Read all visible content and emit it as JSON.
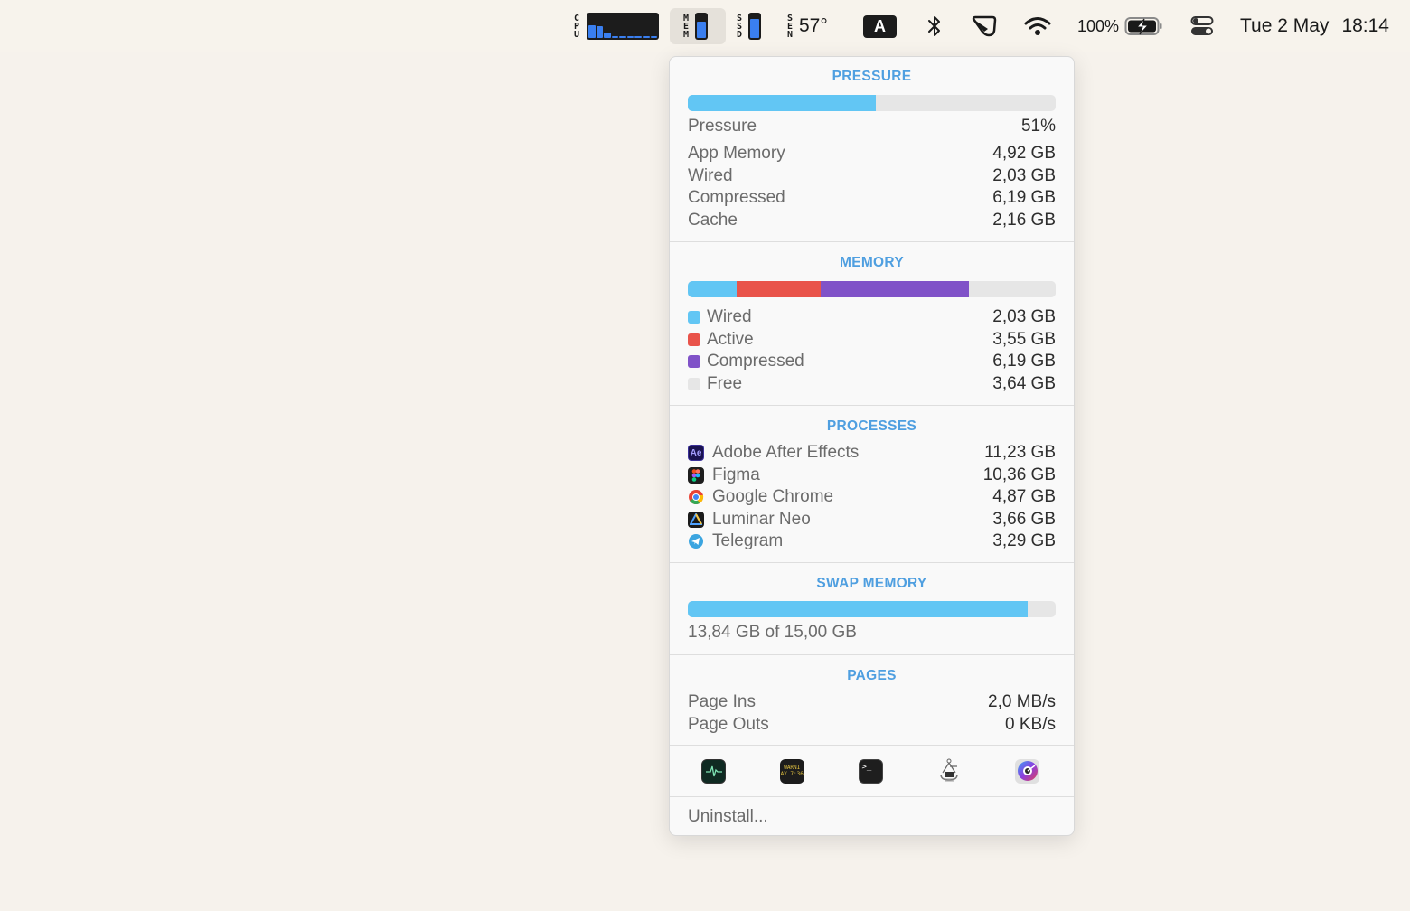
{
  "menubar": {
    "cpu": {
      "label": [
        "C",
        "P",
        "U"
      ],
      "bars": [
        0.55,
        0.5,
        0.22,
        0.05,
        0.05,
        0.05,
        0.05,
        0.05,
        0.05
      ]
    },
    "mem": {
      "label": [
        "M",
        "E",
        "M"
      ],
      "level": 0.7
    },
    "ssd": {
      "label": [
        "S",
        "S",
        "D"
      ],
      "level": 0.8
    },
    "sensors": {
      "label": [
        "S",
        "E",
        "N"
      ],
      "value": "57°"
    },
    "input_source": "A",
    "battery": "100%",
    "date": "Tue 2 May",
    "time": "18:14"
  },
  "colors": {
    "accent": "#4f9fe0",
    "wired": "#62c6f4",
    "active": "#e9534a",
    "compressed": "#8052c8",
    "free": "#e6e6e6"
  },
  "pressure": {
    "title": "PRESSURE",
    "level": 0.51,
    "summary": {
      "label": "Pressure",
      "value": "51%"
    },
    "rows": [
      {
        "label": "App Memory",
        "value": "4,92 GB"
      },
      {
        "label": "Wired",
        "value": "2,03 GB"
      },
      {
        "label": "Compressed",
        "value": "6,19 GB"
      },
      {
        "label": "Cache",
        "value": "2,16 GB"
      }
    ]
  },
  "memory": {
    "title": "MEMORY",
    "rows": [
      {
        "label": "Wired",
        "value": "2,03 GB",
        "gb": 2.03,
        "color": "#62c6f4"
      },
      {
        "label": "Active",
        "value": "3,55 GB",
        "gb": 3.55,
        "color": "#e9534a"
      },
      {
        "label": "Compressed",
        "value": "6,19 GB",
        "gb": 6.19,
        "color": "#8052c8"
      },
      {
        "label": "Free",
        "value": "3,64 GB",
        "gb": 3.64,
        "color": "#e6e6e6"
      }
    ]
  },
  "processes": {
    "title": "PROCESSES",
    "rows": [
      {
        "icon": "after-effects-icon",
        "label": "Adobe After Effects",
        "value": "11,23 GB"
      },
      {
        "icon": "figma-icon",
        "label": "Figma",
        "value": "10,36 GB"
      },
      {
        "icon": "chrome-icon",
        "label": "Google Chrome",
        "value": "4,87 GB"
      },
      {
        "icon": "luminar-neo-icon",
        "label": "Luminar Neo",
        "value": "3,66 GB"
      },
      {
        "icon": "telegram-icon",
        "label": "Telegram",
        "value": "3,29 GB"
      }
    ]
  },
  "swap": {
    "title": "SWAP MEMORY",
    "level": 0.9227,
    "text": "13,84 GB of 15,00 GB"
  },
  "pages": {
    "title": "PAGES",
    "rows": [
      {
        "label": "Page Ins",
        "value": "2,0 MB/s"
      },
      {
        "label": "Page Outs",
        "value": "0 KB/s"
      }
    ]
  },
  "shortcuts": [
    "activity-monitor-icon",
    "console-icon",
    "terminal-icon",
    "system-information-icon",
    "istat-icon"
  ],
  "uninstall_label": "Uninstall..."
}
